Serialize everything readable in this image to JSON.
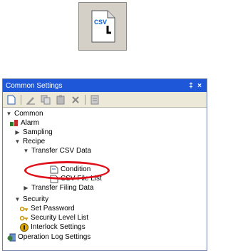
{
  "icon_tile": {
    "glyph_text": "CSV",
    "icon": "csv-file-icon"
  },
  "panel": {
    "title": "Common Settings",
    "pin_glyph": "‡",
    "close_glyph": "×"
  },
  "toolbar": {
    "buttons": [
      "new-icon",
      "edit-icon",
      "copy-icon",
      "paste-icon",
      "delete-icon",
      "properties-icon"
    ]
  },
  "tree": {
    "common": "Common",
    "alarm": "Alarm",
    "sampling": "Sampling",
    "recipe": "Recipe",
    "transfer_csv_data": "Transfer CSV Data",
    "condition": "Condition",
    "csv_file_list": "CSV File List",
    "transfer_filing_data": "Transfer Filing Data",
    "security": "Security",
    "set_password": "Set Password",
    "security_level_list": "Security Level List",
    "interlock_settings": "Interlock Settings",
    "operation_log_settings": "Operation Log Settings"
  },
  "colors": {
    "titlebar": "#1e58d8",
    "highlight": "#e0101a"
  }
}
